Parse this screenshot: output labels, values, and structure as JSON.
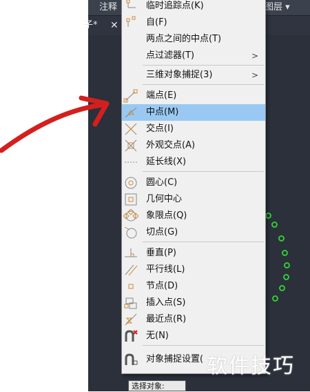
{
  "toolbar": {
    "annotate_tab": "注释",
    "layer_tab": "图层 ▾"
  },
  "drawing_tab": {
    "title": "子*",
    "close": "✕"
  },
  "status": {
    "select_object": "选择对象:"
  },
  "watermark": "软件技巧",
  "menu": {
    "items": [
      {
        "label": "临时追踪点(K)",
        "icon": "temp-track-icon",
        "submenu": false,
        "top": 0
      },
      {
        "label": "自(F)",
        "icon": "from-icon",
        "submenu": false
      },
      {
        "label": "两点之间的中点(T)",
        "icon": "",
        "submenu": false
      },
      {
        "label": "点过滤器(T)",
        "icon": "",
        "submenu": true
      },
      {
        "label": "三维对象捕捉(3)",
        "icon": "",
        "submenu": true
      },
      {
        "label": "端点(E)",
        "icon": "endpoint-icon",
        "submenu": false
      },
      {
        "label": "中点(M)",
        "icon": "midpoint-icon",
        "submenu": false,
        "selected": true
      },
      {
        "label": "交点(I)",
        "icon": "intersection-icon",
        "submenu": false
      },
      {
        "label": "外观交点(A)",
        "icon": "apparent-intersection-icon",
        "submenu": false
      },
      {
        "label": "延长线(X)",
        "icon": "extension-icon",
        "submenu": false
      },
      {
        "label": "圆心(C)",
        "icon": "center-icon",
        "submenu": false
      },
      {
        "label": "几何中心",
        "icon": "geometric-center-icon",
        "submenu": false
      },
      {
        "label": "象限点(Q)",
        "icon": "quadrant-icon",
        "submenu": false
      },
      {
        "label": "切点(G)",
        "icon": "tangent-icon",
        "submenu": false
      },
      {
        "label": "垂直(P)",
        "icon": "perpendicular-icon",
        "submenu": false
      },
      {
        "label": "平行线(L)",
        "icon": "parallel-icon",
        "submenu": false
      },
      {
        "label": "节点(D)",
        "icon": "node-icon",
        "submenu": false
      },
      {
        "label": "插入点(S)",
        "icon": "insertion-icon",
        "submenu": false
      },
      {
        "label": "最近点(R)",
        "icon": "nearest-icon",
        "submenu": false
      },
      {
        "label": "无(N)",
        "icon": "none-icon",
        "submenu": false
      },
      {
        "label": "对象捕捉设置(",
        "icon": "osnap-settings-icon",
        "submenu": false
      }
    ]
  }
}
